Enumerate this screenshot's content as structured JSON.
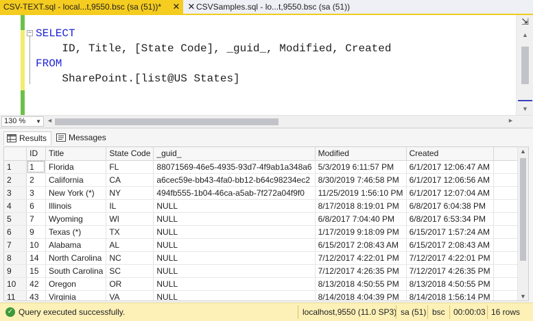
{
  "tabs": [
    {
      "label": "CSV-TEXT.sql - local...t,9550.bsc (sa (51))*",
      "close": "✕",
      "active": true
    },
    {
      "label": "CSVSamples.sql - lo...t,9550.bsc (sa (51))",
      "close": "✕",
      "active": false
    }
  ],
  "editor": {
    "lines": [
      [
        {
          "t": "SELECT",
          "kw": true
        }
      ],
      [
        {
          "t": "    ID, Title, [State Code], _guid_, Modified, Created",
          "kw": false
        }
      ],
      [
        {
          "t": "FROM",
          "kw": true
        }
      ],
      [
        {
          "t": "    SharePoint.[list@US States]",
          "kw": false
        }
      ]
    ],
    "collapse_glyph": "−",
    "split_glyph": "⇲",
    "scroll_up": "▲",
    "scroll_down": "▼"
  },
  "zoom": {
    "value": "130 %",
    "dropdown": "▼"
  },
  "hscroll": {
    "left": "◄",
    "right": "►"
  },
  "results_tabs": {
    "results": "Results",
    "messages": "Messages"
  },
  "grid": {
    "columns": [
      "ID",
      "Title",
      "State Code",
      "_guid_",
      "Modified",
      "Created"
    ],
    "rows": [
      [
        "1",
        "1",
        "Florida",
        "FL",
        "88071569-46e5-4935-93d7-4f9ab1a348a6",
        "5/3/2019 6:11:57 PM",
        "6/1/2017 12:06:47 AM"
      ],
      [
        "2",
        "2",
        "California",
        "CA",
        "a6cec59e-bb43-4fa0-bb12-b64c98234ec2",
        "8/30/2019 7:46:58 PM",
        "6/1/2017 12:06:56 AM"
      ],
      [
        "3",
        "3",
        "New York (*)",
        "NY",
        "494fb555-1b04-46ca-a5ab-7f272a04f9f0",
        "11/25/2019 1:56:10 PM",
        "6/1/2017 12:07:04 AM"
      ],
      [
        "4",
        "6",
        "Illinois",
        "IL",
        "NULL",
        "8/17/2018 8:19:01 PM",
        "6/8/2017 6:04:38 PM"
      ],
      [
        "5",
        "7",
        "Wyoming",
        "WI",
        "NULL",
        "6/8/2017 7:04:40 PM",
        "6/8/2017 6:53:34 PM"
      ],
      [
        "6",
        "9",
        "Texas (*)",
        "TX",
        "NULL",
        "1/17/2019 9:18:09 PM",
        "6/15/2017 1:57:24 AM"
      ],
      [
        "7",
        "10",
        "Alabama",
        "AL",
        "NULL",
        "6/15/2017 2:08:43 AM",
        "6/15/2017 2:08:43 AM"
      ],
      [
        "8",
        "14",
        "North Carolina",
        "NC",
        "NULL",
        "7/12/2017 4:22:01 PM",
        "7/12/2017 4:22:01 PM"
      ],
      [
        "9",
        "15",
        "South Carolina",
        "SC",
        "NULL",
        "7/12/2017 4:26:35 PM",
        "7/12/2017 4:26:35 PM"
      ],
      [
        "10",
        "42",
        "Oregon",
        "OR",
        "NULL",
        "8/13/2018 4:50:55 PM",
        "8/13/2018 4:50:55 PM"
      ],
      [
        "11",
        "43",
        "Virginia",
        "VA",
        "NULL",
        "8/14/2018 4:04:39 PM",
        "8/14/2018 1:56:14 PM"
      ]
    ],
    "null_color": "#fbfbe0",
    "scroll_up": "▲",
    "scroll_down": "▼"
  },
  "status": {
    "icon": "✓",
    "message": "Query executed successfully.",
    "server": "localhost,9550 (11.0 SP3)",
    "user": "sa (51)",
    "database": "bsc",
    "elapsed": "00:00:03",
    "rows": "16 rows",
    "bg_color": "#fdf1b8"
  }
}
